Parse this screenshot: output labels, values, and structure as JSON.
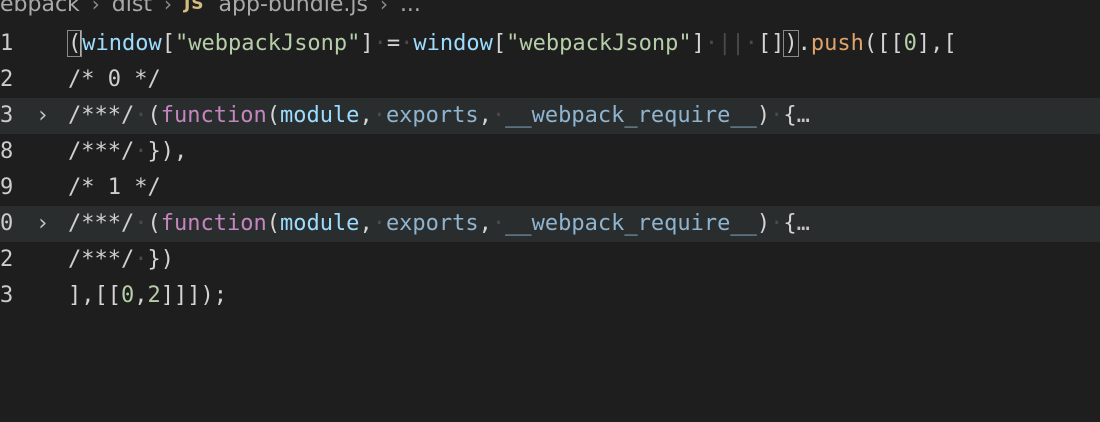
{
  "breadcrumb": {
    "parts": [
      "ebpack",
      "dist",
      "app-bundle.js",
      "..."
    ],
    "file_icon": "JS"
  },
  "editor": {
    "lines": [
      {
        "number": "1",
        "fold": ""
      },
      {
        "number": "2",
        "fold": ""
      },
      {
        "number": "3",
        "fold": "›"
      },
      {
        "number": "8",
        "fold": ""
      },
      {
        "number": "9",
        "fold": ""
      },
      {
        "number": "0",
        "fold": "›"
      },
      {
        "number": "2",
        "fold": ""
      },
      {
        "number": "3",
        "fold": ""
      }
    ],
    "tokens": {
      "window": "window",
      "webpackJsonp": "\"webpackJsonp\"",
      "push": "push",
      "comment0": "/* 0 */",
      "comment1": "/* 1 */",
      "star_comment": "/***/",
      "function_kw": "function",
      "module": "module",
      "exports": "exports",
      "require": "__webpack_require__",
      "fold_ellipsis": "…",
      "last_line": "],[[0,2]]]);"
    }
  },
  "colors": {
    "background": "#1e1e1e",
    "string": "#ce9178",
    "keyword": "#c586c0",
    "identifier": "#9cdcfe",
    "method": "#e0a36a"
  }
}
